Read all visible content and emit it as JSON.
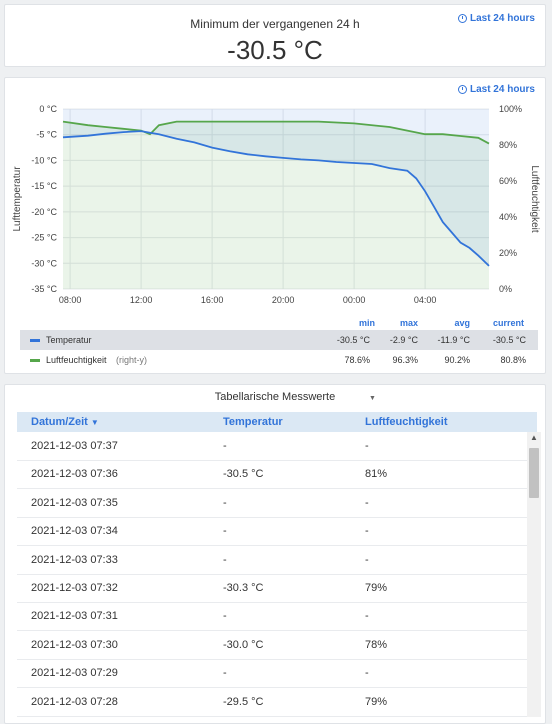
{
  "stat_panel": {
    "title": "Minimum der vergangenen 24 h",
    "value": "-30.5 °C",
    "time_range": "Last 24 hours"
  },
  "graph_panel": {
    "time_range": "Last 24 hours",
    "left_axis_label": "Lufttemperatur",
    "right_axis_label": "Luftfeuchtigkeit",
    "left_ticks": [
      "0 °C",
      "-5 °C",
      "-10 °C",
      "-15 °C",
      "-20 °C",
      "-25 °C",
      "-30 °C",
      "-35 °C"
    ],
    "right_ticks": [
      "100%",
      "80%",
      "60%",
      "40%",
      "20%",
      "0%"
    ],
    "x_ticks": [
      "08:00",
      "12:00",
      "16:00",
      "20:00",
      "00:00",
      "04:00"
    ],
    "legend": {
      "headers": [
        "min",
        "max",
        "avg",
        "current"
      ],
      "rows": [
        {
          "name": "Temperatur",
          "suffix": "",
          "color": "#3274d9",
          "min": "-30.5 °C",
          "max": "-2.9 °C",
          "avg": "-11.9 °C",
          "current": "-30.5 °C"
        },
        {
          "name": "Luftfeuchtigkeit",
          "suffix": "(right-y)",
          "color": "#56a64b",
          "min": "78.6%",
          "max": "96.3%",
          "avg": "90.2%",
          "current": "80.8%"
        }
      ]
    }
  },
  "chart_data": {
    "type": "line",
    "x_label": "",
    "x_ticks": [
      "08:00",
      "12:00",
      "16:00",
      "20:00",
      "00:00",
      "04:00"
    ],
    "x_range_hours": [
      7.6,
      31.6
    ],
    "y_left": {
      "label": "Lufttemperatur",
      "range": [
        -35,
        0
      ],
      "unit": "°C"
    },
    "y_right": {
      "label": "Luftfeuchtigkeit",
      "range": [
        0,
        100
      ],
      "unit": "%"
    },
    "series": [
      {
        "name": "Temperatur",
        "axis": "left",
        "color": "#3274d9",
        "x": [
          7.6,
          9,
          10,
          11,
          12,
          12.5,
          13,
          14,
          15,
          16,
          17,
          18,
          19,
          20,
          21,
          22,
          23,
          24,
          25,
          26,
          27,
          27.5,
          28,
          28.5,
          29,
          29.5,
          30,
          30.5,
          31,
          31.6
        ],
        "y": [
          -5.5,
          -5.2,
          -4.8,
          -4.5,
          -4.3,
          -4.6,
          -4.9,
          -5.8,
          -6.5,
          -7.5,
          -8.2,
          -8.8,
          -9.2,
          -9.5,
          -9.8,
          -10.0,
          -10.3,
          -10.5,
          -10.7,
          -11.5,
          -12.0,
          -13.5,
          -16,
          -19,
          -22,
          -24,
          -26,
          -27,
          -28.5,
          -30.5
        ]
      },
      {
        "name": "Luftfeuchtigkeit",
        "axis": "right",
        "color": "#56a64b",
        "x": [
          7.6,
          9,
          10,
          11,
          12,
          12.5,
          13,
          14,
          16,
          18,
          20,
          22,
          24,
          26,
          27,
          28,
          29,
          30,
          31,
          31.6
        ],
        "y": [
          93,
          91,
          90,
          89,
          88,
          86,
          91,
          93,
          93,
          93,
          93,
          93,
          92,
          90,
          88,
          86,
          86,
          85,
          84,
          80.8
        ]
      }
    ]
  },
  "table_panel": {
    "title": "Tabellarische Messwerte",
    "columns": [
      "Datum/Zeit",
      "Temperatur",
      "Luftfeuchtigkeit"
    ],
    "rows": [
      [
        "2021-12-03 07:37",
        "-",
        "-"
      ],
      [
        "2021-12-03 07:36",
        "-30.5 °C",
        "81%"
      ],
      [
        "2021-12-03 07:35",
        "-",
        "-"
      ],
      [
        "2021-12-03 07:34",
        "-",
        "-"
      ],
      [
        "2021-12-03 07:33",
        "-",
        "-"
      ],
      [
        "2021-12-03 07:32",
        "-30.3 °C",
        "79%"
      ],
      [
        "2021-12-03 07:31",
        "-",
        "-"
      ],
      [
        "2021-12-03 07:30",
        "-30.0 °C",
        "78%"
      ],
      [
        "2021-12-03 07:29",
        "-",
        "-"
      ],
      [
        "2021-12-03 07:28",
        "-29.5 °C",
        "79%"
      ]
    ]
  }
}
